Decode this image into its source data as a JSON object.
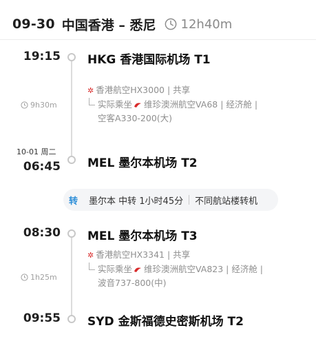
{
  "header": {
    "date": "09-30",
    "route": "中国香港 – 悉尼",
    "duration": "12h40m",
    "clock_icon": "clock-icon"
  },
  "segments": [
    {
      "depart_time": "19:15",
      "depart_airport": "HKG 香港国际机场 T1",
      "operated_line1": "香港航空HX3000 | 共享",
      "operated_line2": "实际乘坐",
      "operated_line2b": "维珍澳洲航空VA68 | 经济舱 |",
      "operated_line3": "空客A330-200(大)",
      "duration": "9h30m",
      "arrive_date": "10-01 周二",
      "arrive_time": "06:45",
      "arrive_airport": "MEL 墨尔本机场 T2"
    },
    {
      "depart_time": "08:30",
      "depart_airport": "MEL 墨尔本机场 T3",
      "operated_line1": "香港航空HX3341 | 共享",
      "operated_line2": "实际乘坐",
      "operated_line2b": "维珍澳洲航空VA823 | 经济舱 |",
      "operated_line3": "波音737-800(中)",
      "duration": "1h25m",
      "arrive_time": "09:55",
      "arrive_airport": "SYD 金斯福德史密斯机场 T2"
    }
  ],
  "transfer": {
    "badge": "转",
    "text": "墨尔本 中转 1小时45分",
    "note": "不同航站楼转机"
  },
  "colors": {
    "accent_blue": "#2e8fd8",
    "airline_red": "#d82a2a",
    "muted_text": "#8f8f8f"
  }
}
